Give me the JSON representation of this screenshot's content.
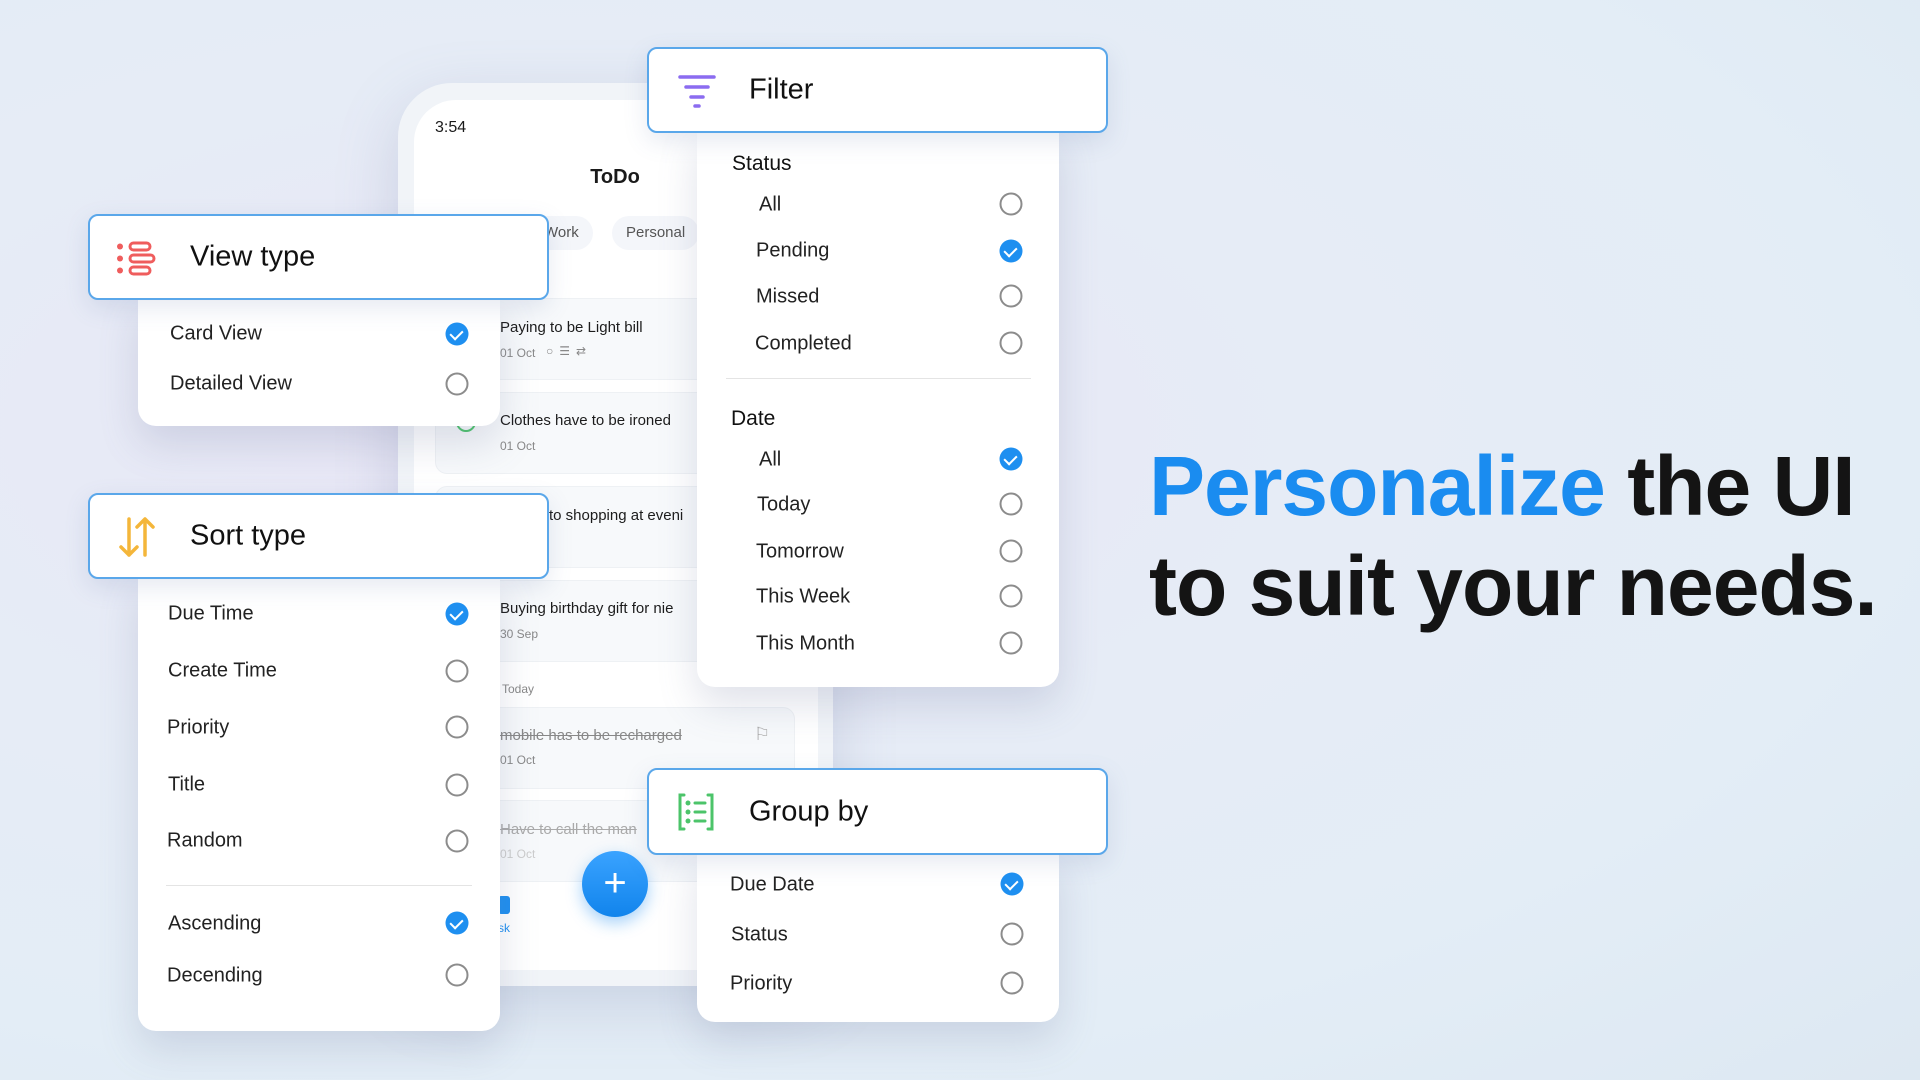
{
  "phone": {
    "time": "3:54",
    "title": "ToDo",
    "chips": [
      "Work",
      "Personal"
    ],
    "tasks": [
      {
        "title": "Paying to be Light bill",
        "date": "01 Oct"
      },
      {
        "title": "Clothes have to be ironed",
        "date": "01 Oct"
      },
      {
        "title": "to shopping at eveni"
      },
      {
        "title": "Buying birthday gift for nie",
        "date": "30 Sep"
      },
      {
        "title": "mobile has to be recharged",
        "date": "01 Oct"
      },
      {
        "title": "Have to call the man",
        "date": "01 Oct"
      }
    ],
    "section_today": "Today",
    "nav_partial": "sk"
  },
  "view_type": {
    "title": "View type",
    "icon": "list-icon",
    "color": "#ef5d5d",
    "options": [
      {
        "label": "Card View",
        "checked": true
      },
      {
        "label": "Detailed View",
        "checked": false
      }
    ]
  },
  "sort_type": {
    "title": "Sort type",
    "icon": "sort-arrows-icon",
    "color": "#f4b63a",
    "fields": [
      {
        "label": "Due Time",
        "checked": true
      },
      {
        "label": "Create Time",
        "checked": false
      },
      {
        "label": "Priority",
        "checked": false
      },
      {
        "label": "Title",
        "checked": false
      },
      {
        "label": "Random",
        "checked": false
      }
    ],
    "order": [
      {
        "label": "Ascending",
        "checked": true
      },
      {
        "label": "Decending",
        "checked": false
      }
    ]
  },
  "filter": {
    "title": "Filter",
    "icon": "filter-icon",
    "color": "#8b6cf0",
    "status_heading": "Status",
    "status": [
      {
        "label": "All",
        "checked": false
      },
      {
        "label": "Pending",
        "checked": true
      },
      {
        "label": "Missed",
        "checked": false
      },
      {
        "label": "Completed",
        "checked": false
      }
    ],
    "date_heading": "Date",
    "date": [
      {
        "label": "All",
        "checked": true
      },
      {
        "label": "Today",
        "checked": false
      },
      {
        "label": "Tomorrow",
        "checked": false
      },
      {
        "label": "This Week",
        "checked": false
      },
      {
        "label": "This Month",
        "checked": false
      }
    ]
  },
  "group_by": {
    "title": "Group by",
    "icon": "grouped-list-icon",
    "color": "#4cc46a",
    "options": [
      {
        "label": "Due Date",
        "checked": true
      },
      {
        "label": "Status",
        "checked": false
      },
      {
        "label": "Priority",
        "checked": false
      }
    ]
  },
  "headline": {
    "highlight": "Personalize",
    "rest1": " the UI",
    "line2": "to suit your needs.",
    "accent": "#1a8cf0"
  }
}
